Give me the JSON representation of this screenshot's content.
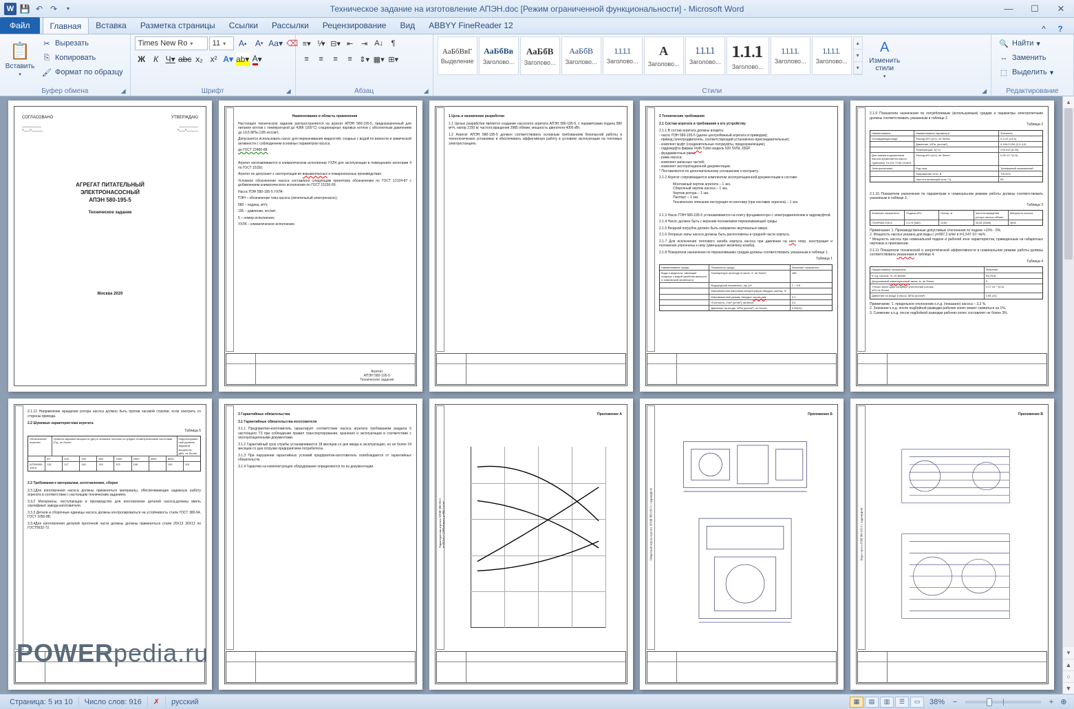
{
  "titlebar": {
    "title": "Техническое задание на изготовление АПЭН.doc [Режим ограниченной функциональности] - Microsoft Word"
  },
  "tabs": {
    "file": "Файл",
    "items": [
      "Главная",
      "Вставка",
      "Разметка страницы",
      "Ссылки",
      "Рассылки",
      "Рецензирование",
      "Вид",
      "ABBYY FineReader 12"
    ]
  },
  "ribbon": {
    "clipboard": {
      "label": "Буфер обмена",
      "paste": "Вставить",
      "cut": "Вырезать",
      "copy": "Копировать",
      "format": "Формат по образцу"
    },
    "font": {
      "label": "Шрифт",
      "name": "Times New Ro",
      "size": "11"
    },
    "paragraph": {
      "label": "Абзац"
    },
    "styles": {
      "label": "Стили",
      "items": [
        {
          "sample": "АаБбВвГ",
          "name": "Выделение"
        },
        {
          "sample": "АаБбВв",
          "name": "Заголово..."
        },
        {
          "sample": "АаБбВ",
          "name": "Заголово..."
        },
        {
          "sample": "АаБбВ",
          "name": "Заголово..."
        },
        {
          "sample": "1.1.1.1",
          "name": "Заголово..."
        },
        {
          "sample": "А",
          "name": "Заголово..."
        },
        {
          "sample": "1.1.1.1",
          "name": "Заголово..."
        },
        {
          "sample": "1.1.1",
          "name": "Заголово..."
        },
        {
          "sample": "1.1.1.1.",
          "name": "Заголово..."
        },
        {
          "sample": "1.1.1.1.",
          "name": "Заголово..."
        }
      ],
      "change": "Изменить стили"
    },
    "editing": {
      "label": "Редактирование",
      "find": "Найти",
      "replace": "Заменить",
      "select": "Выделить"
    }
  },
  "pages": {
    "p1": {
      "left": "СОГЛАСОВАНО",
      "right": "УТВЕРЖДАЮ",
      "title1": "АГРЕГАТ ПИТАТЕЛЬНЫЙ",
      "title2": "ЭЛЕКТРОНАСОСНЫЙ",
      "title3": "АПЭН 580-195-5",
      "sub": "Техническое задание",
      "city": "Москва 2020"
    },
    "p2": {
      "h": "Наименование и область применения",
      "stamp1": "Агрегат",
      "stamp2": "АПЭН 580-195-5",
      "stamp3": "Техническое задание"
    },
    "p3": {
      "h": "1   Цель и назначение разработки"
    },
    "p4": {
      "h": "2   Технические требования",
      "sub": "2.1 Состав агрегата и требования к его устройству"
    },
    "p6": {
      "sub": "2.2 Шумовые характеристики агрегата",
      "sub2": "2.3 Требования к материалам, изготовлению, сборке"
    },
    "p7": {
      "h": "3   Гарантийные обязательства",
      "sub": "3.1   Гарантийные обязательства изготовителя"
    },
    "p8": {
      "h": "Приложение А"
    },
    "p9": {
      "h": "Приложение Б"
    },
    "p10": {
      "h": "Приложение В"
    }
  },
  "watermark": {
    "bold": "POWER",
    "rest": "pedia.ru"
  },
  "status": {
    "page": "Страница: 5 из 10",
    "words": "Число слов: 916",
    "lang": "русский",
    "zoom": "38%"
  }
}
